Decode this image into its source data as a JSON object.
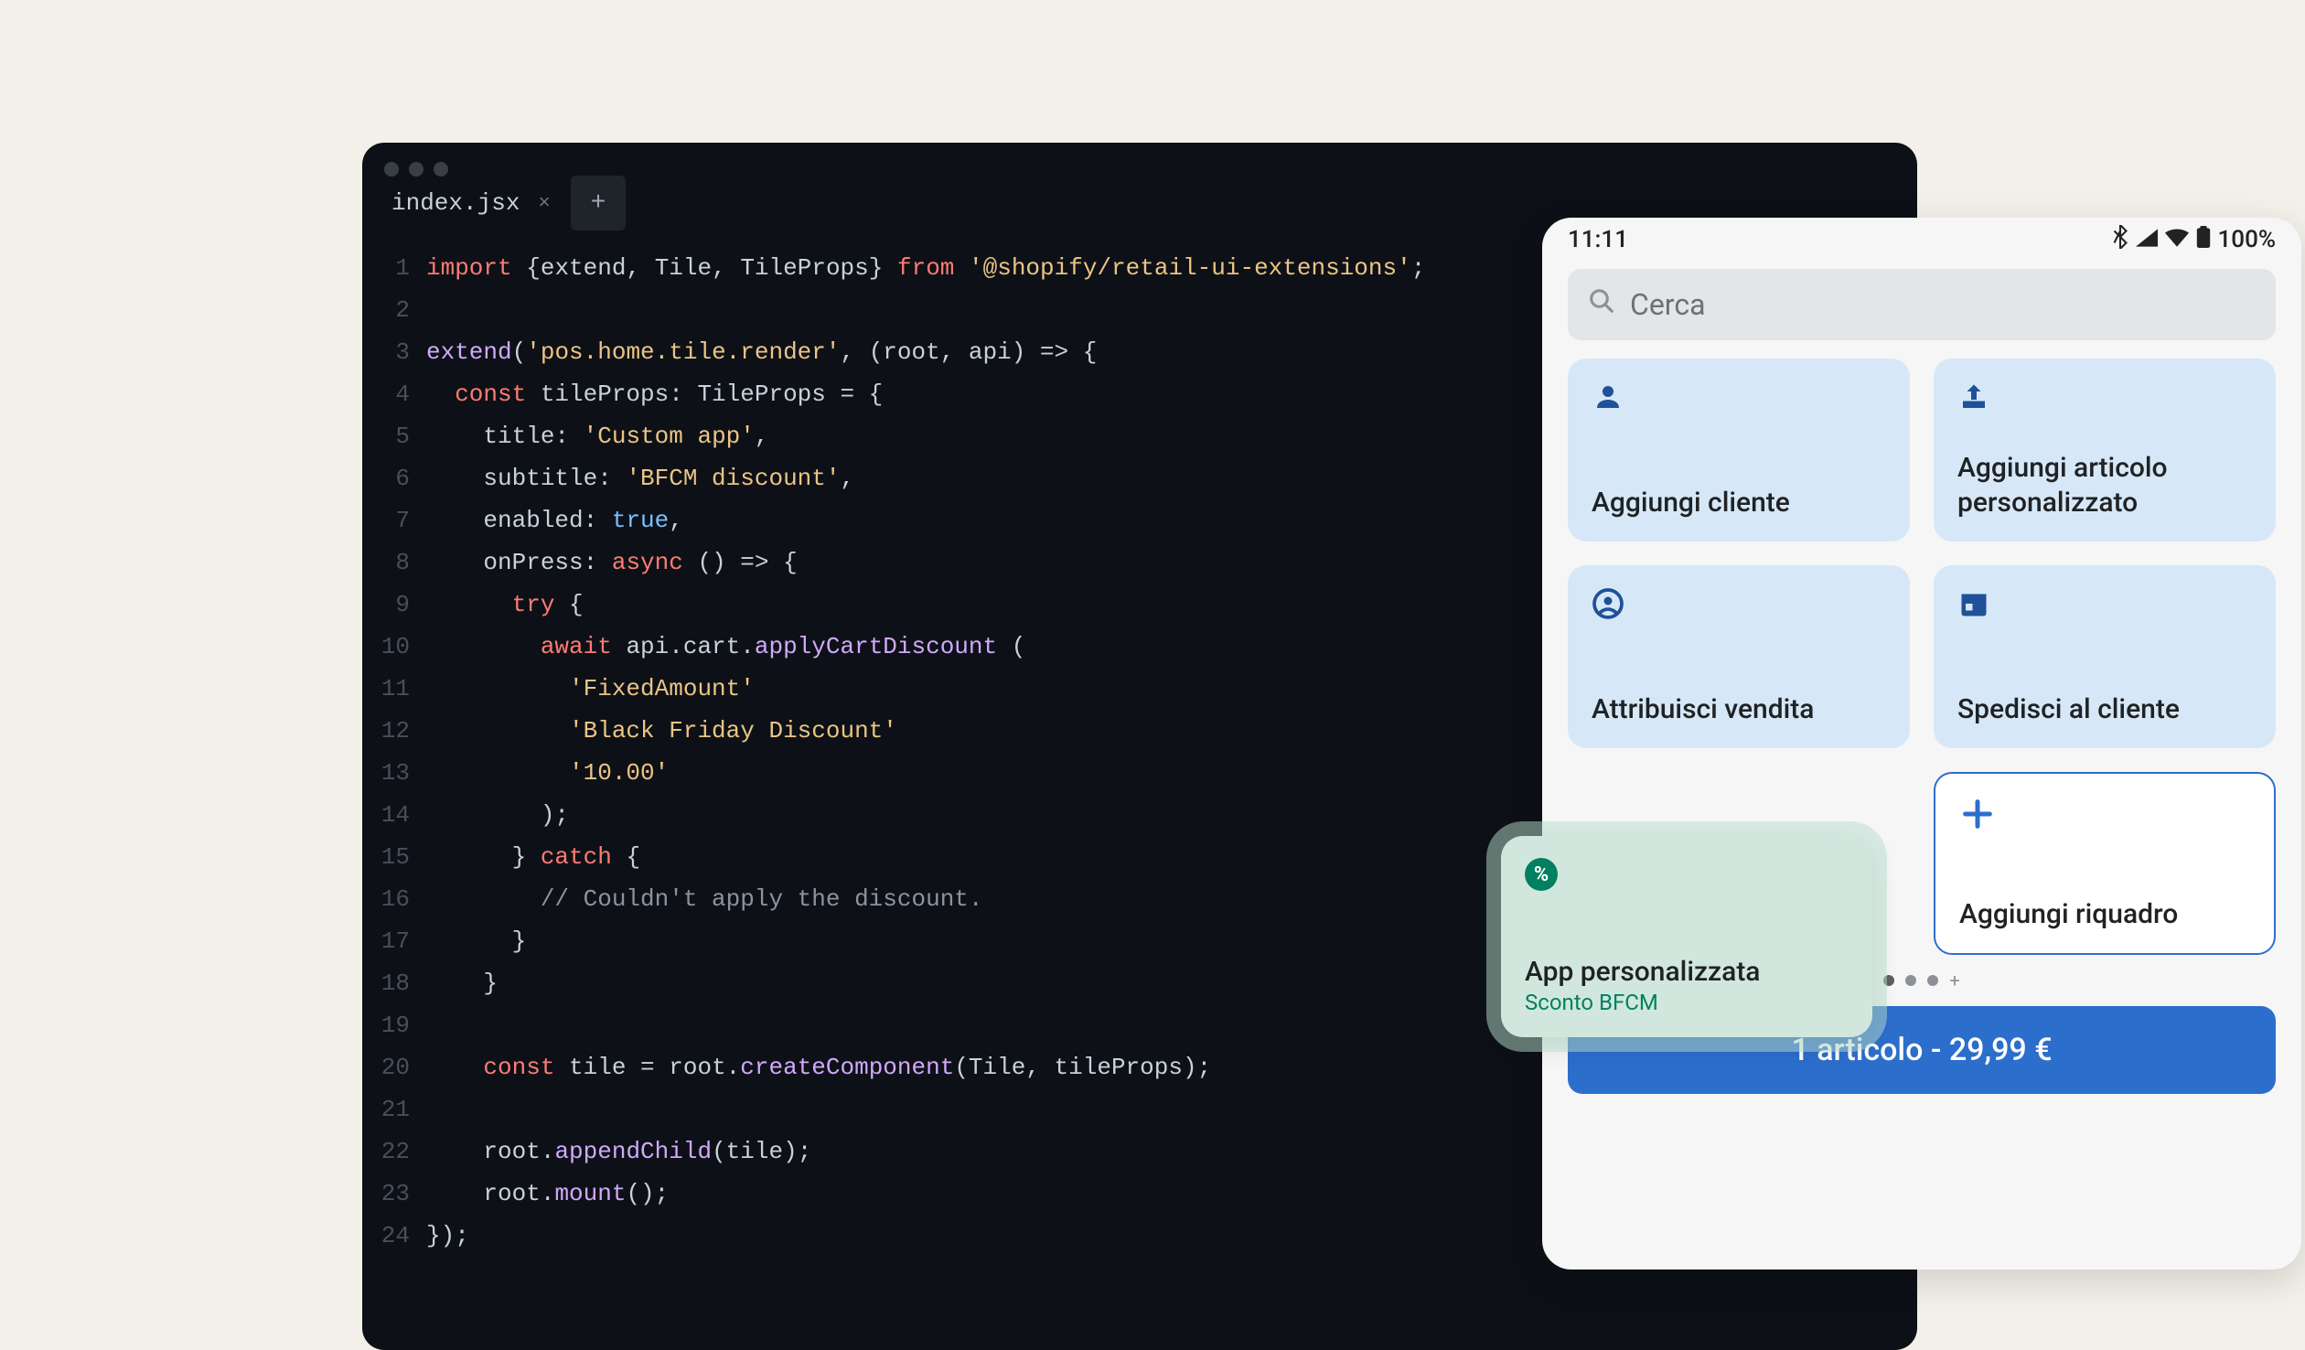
{
  "editor": {
    "tab_name": "index.jsx",
    "line_numbers": [
      "1",
      "2",
      "3",
      "4",
      "5",
      "6",
      "7",
      "8",
      "9",
      "10",
      "11",
      "12",
      "13",
      "14",
      "15",
      "16",
      "17",
      "18",
      "19",
      "20",
      "21",
      "22",
      "23",
      "24"
    ],
    "code": {
      "l1_import": "import",
      "l1_brace_open": " {",
      "l1_extend": "extend",
      "l1_c1": ", ",
      "l1_tile": "Tile",
      "l1_c2": ", ",
      "l1_tileprops": "TileProps",
      "l1_brace_close": "} ",
      "l1_from": "from",
      "l1_pkg": "'@shopify/retail-ui-extensions'",
      "l1_semi": ";",
      "l3_fn": "extend",
      "l3_open": "(",
      "l3_str": "'pos.home.tile.render'",
      "l3_rest": ", (root, api) => {",
      "l4_const": "  const",
      "l4_var": " tileProps: TileProps = {",
      "l5_key": "    title: ",
      "l5_val": "'Custom app'",
      "l5_c": ",",
      "l6_key": "    subtitle: ",
      "l6_val": "'BFCM discount'",
      "l6_c": ",",
      "l7_key": "    enabled: ",
      "l7_val": "true",
      "l7_c": ",",
      "l8_key": "    onPress: ",
      "l8_async": "async",
      "l8_rest": " () => {",
      "l9_try": "      try",
      "l9_brace": " {",
      "l10_await": "        await",
      "l10_apicart": " api.cart.",
      "l10_fn": "applyCartDiscount",
      "l10_paren": " (",
      "l11": "          'FixedAmount'",
      "l12": "          'Black Friday Discount'",
      "l13": "          '10.00'",
      "l14": "        );",
      "l15_a": "      } ",
      "l15_catch": "catch",
      "l15_b": " {",
      "l16": "        // Couldn't apply the discount.",
      "l17": "      }",
      "l18": "    }",
      "l20_a": "    const",
      "l20_b": " tile = root.",
      "l20_fn": "createComponent",
      "l20_c": "(Tile, tileProps);",
      "l22_a": "    root.",
      "l22_fn": "appendChild",
      "l22_b": "(tile);",
      "l23_a": "    root.",
      "l23_fn": "mount",
      "l23_b": "();",
      "l24": "});"
    }
  },
  "phone": {
    "status_time": "11:11",
    "status_battery": "100%",
    "search_placeholder": "Cerca",
    "tiles": {
      "add_customer": "Aggiungi cliente",
      "custom_item": "Aggiungi articolo personalizzato",
      "attribute_sale": "Attribuisci vendita",
      "ship_customer": "Spedisci al cliente",
      "add_tile": "Aggiungi riquadro"
    },
    "checkout_label": "1 articolo - 29,99 €"
  },
  "custom_tile": {
    "title": "App personalizzata",
    "subtitle": "Sconto BFCM"
  }
}
